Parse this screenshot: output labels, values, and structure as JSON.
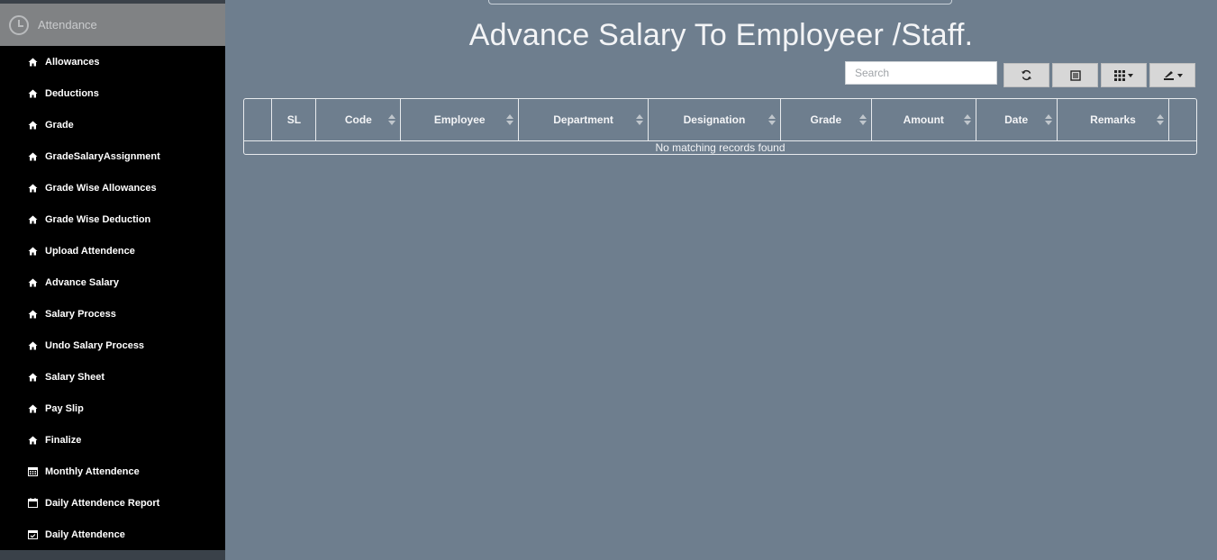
{
  "sidebar": {
    "header_title": "Attendance",
    "items": [
      {
        "label": "Allowances",
        "icon": "home-icon"
      },
      {
        "label": "Deductions",
        "icon": "home-icon"
      },
      {
        "label": "Grade",
        "icon": "home-icon"
      },
      {
        "label": "GradeSalaryAssignment",
        "icon": "home-icon"
      },
      {
        "label": "Grade Wise Allowances",
        "icon": "home-icon"
      },
      {
        "label": "Grade Wise Deduction",
        "icon": "home-icon"
      },
      {
        "label": "Upload Attendence",
        "icon": "home-icon"
      },
      {
        "label": "Advance Salary",
        "icon": "home-icon"
      },
      {
        "label": "Salary Process",
        "icon": "home-icon"
      },
      {
        "label": "Undo Salary Process",
        "icon": "home-icon"
      },
      {
        "label": "Salary Sheet",
        "icon": "home-icon"
      },
      {
        "label": "Pay Slip",
        "icon": "home-icon"
      },
      {
        "label": "Finalize",
        "icon": "home-icon"
      },
      {
        "label": "Monthly Attendence",
        "icon": "calendar-grid-icon"
      },
      {
        "label": "Daily Attendence Report",
        "icon": "calendar-icon"
      },
      {
        "label": "Daily Attendence",
        "icon": "calendar-check-icon"
      }
    ]
  },
  "main": {
    "title": "Advance Salary To Employeer /Staff.",
    "search": {
      "placeholder": "Search",
      "value": ""
    },
    "toolbar": [
      "refresh-icon",
      "toggle-view-icon",
      "columns-icon",
      "export-icon"
    ],
    "table": {
      "columns": [
        "",
        "SL",
        "Code",
        "Employee",
        "Department",
        "Designation",
        "Grade",
        "Amount",
        "Date",
        "Remarks",
        ""
      ],
      "empty_message": "No matching records found"
    }
  },
  "colors": {
    "background": "#6e7e8e",
    "sidebar": "#000000",
    "sidebar_header": "#808284",
    "text_light": "#f3f4f6"
  }
}
